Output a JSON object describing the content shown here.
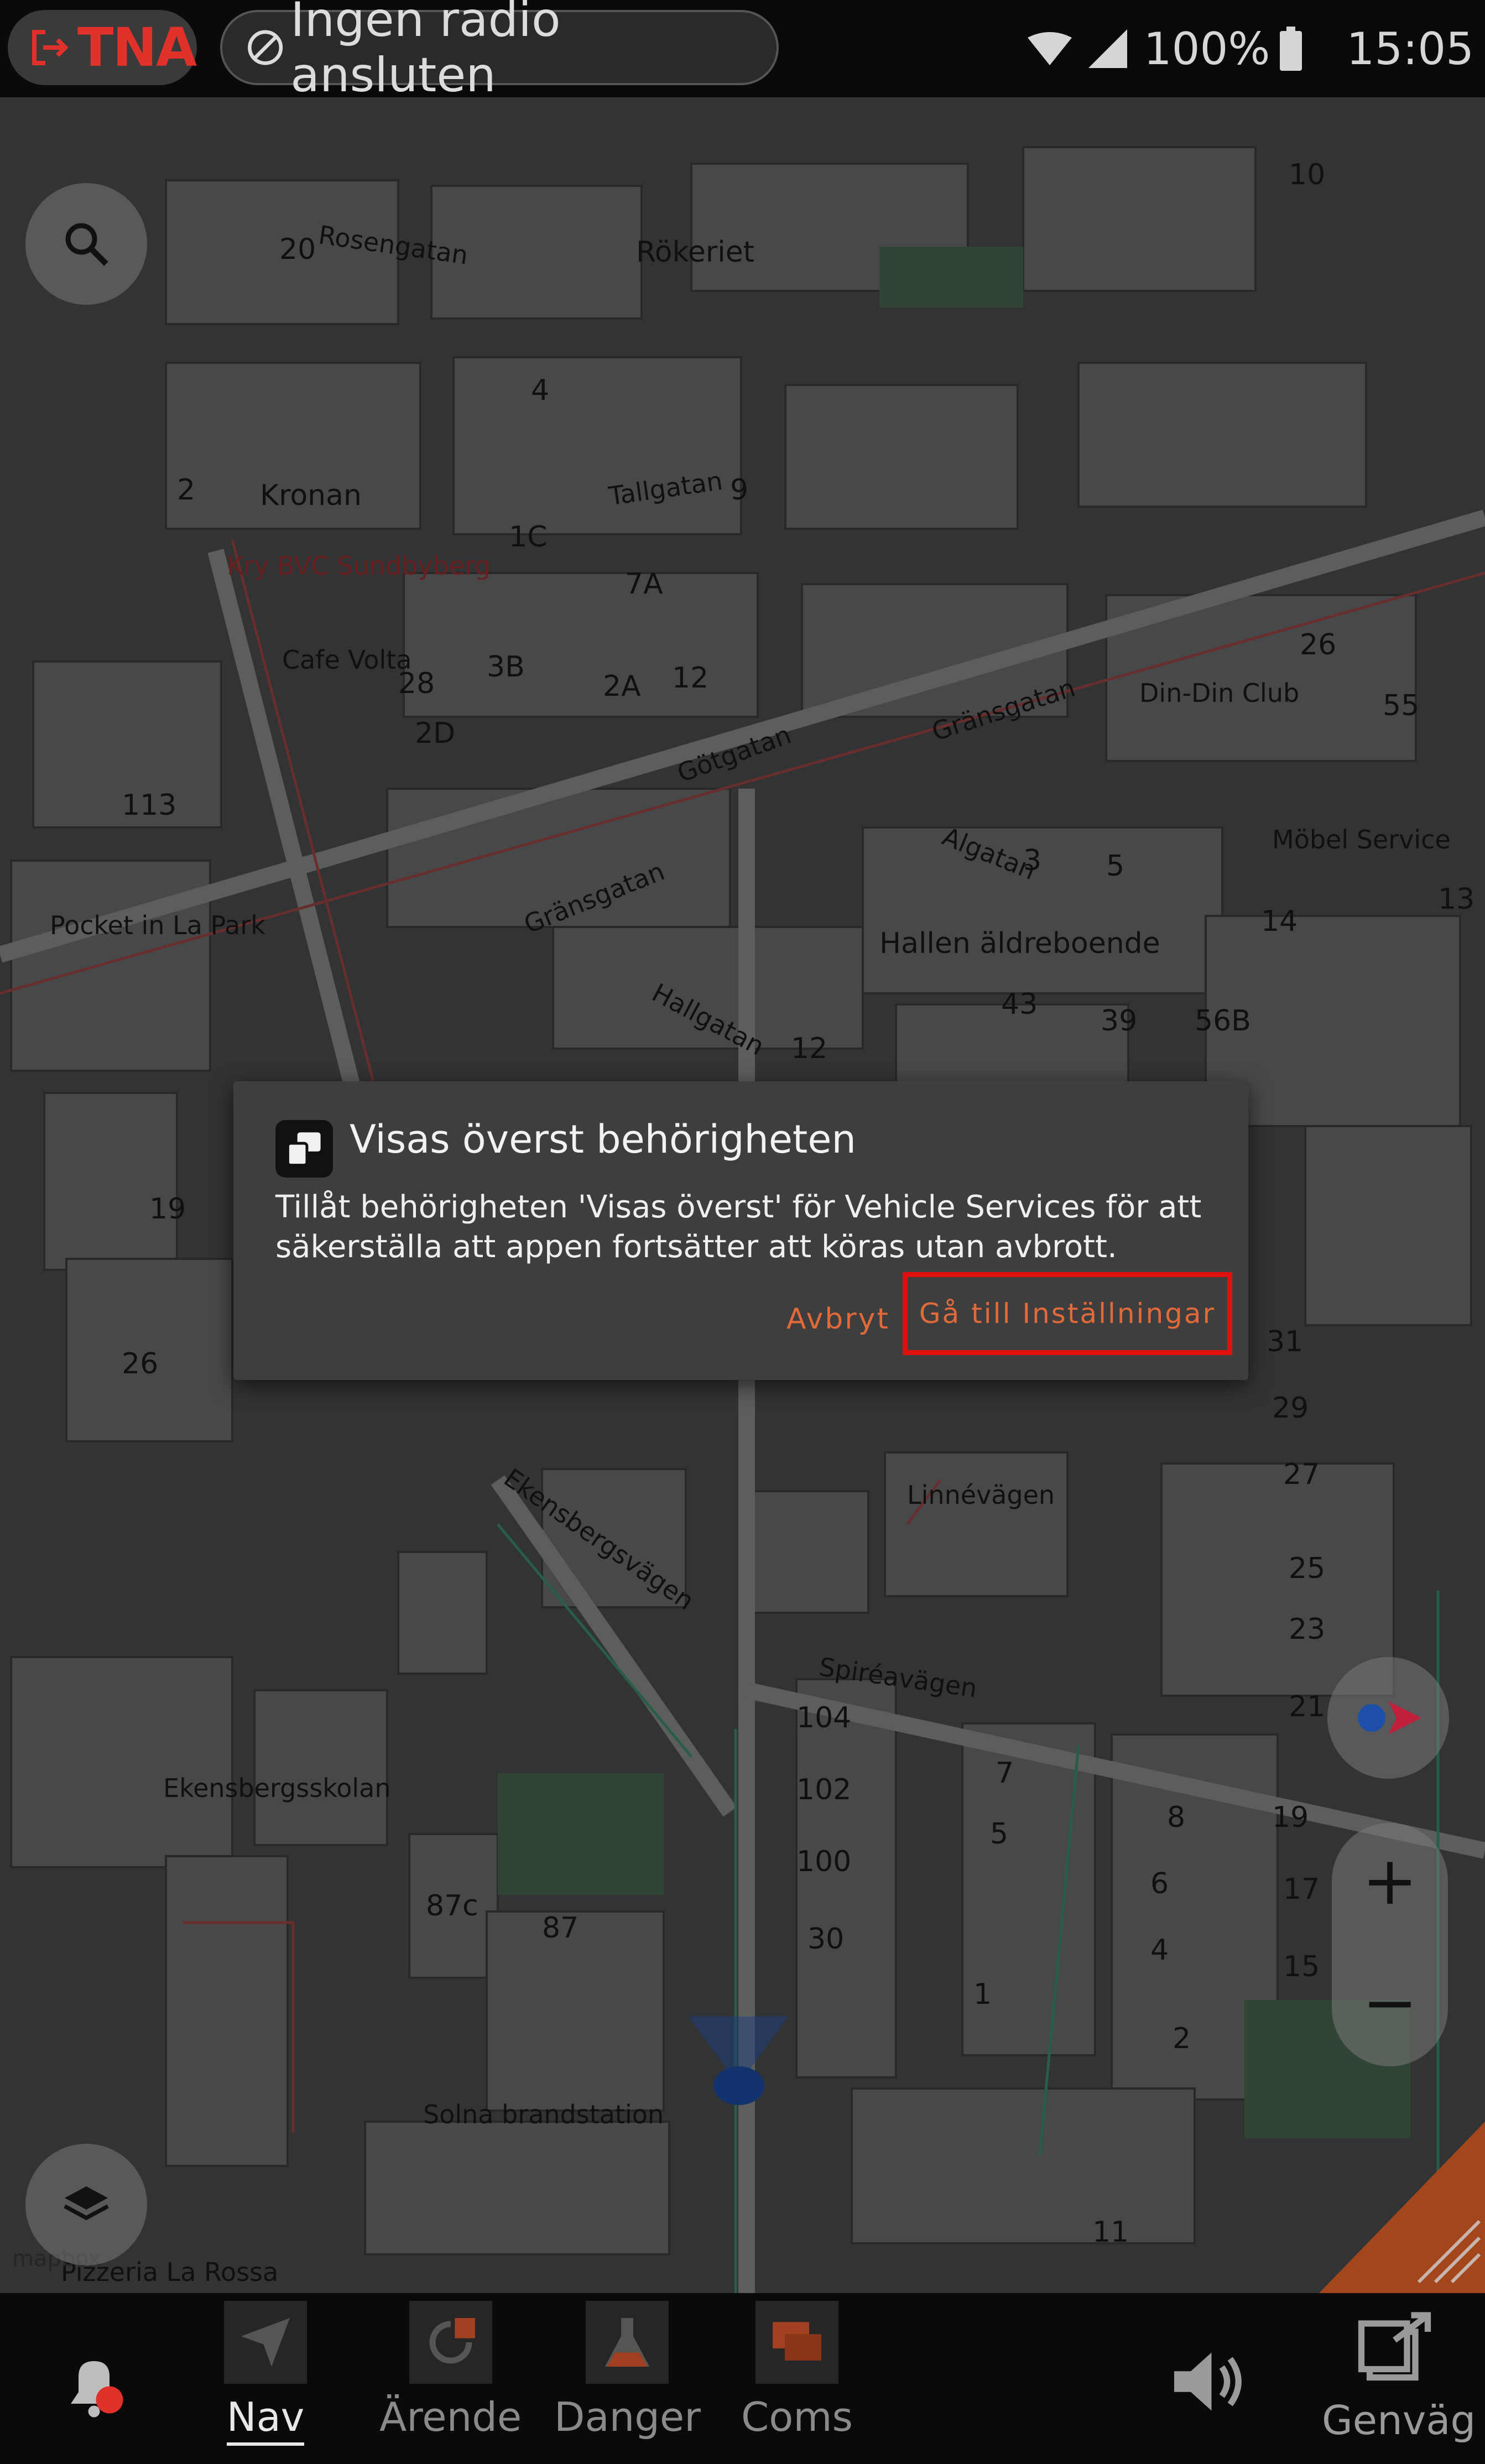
{
  "status_bar": {
    "app_badge": "TNA",
    "radio_status": "Ingen radio ansluten",
    "battery": "100%",
    "time": "15:05"
  },
  "map": {
    "labels": {
      "rokeriet": "Rökeriet",
      "kronan": "Kronan",
      "gransgatan": "Gränsgatan",
      "gransgatan2": "Gränsgatan",
      "gotgatan": "Götgatan",
      "hallen": "Hallen äldreboende",
      "linnevagen": "Linnévägen",
      "spireavagen": "Spiréavägen",
      "ekensbergsvagen": "Ekensbergsvägen",
      "ekensbergsskolan": "Ekensbergsskolan",
      "brandstation": "Solna brandstation",
      "pizzeria": "Pizzeria La Rossa",
      "pocket": "Pocket in La Park",
      "cafe_volta": "Cafe Volta",
      "din_din": "Din-Din Club",
      "mobel": "Möbel Service",
      "tallgatan": "Tallgatan",
      "kry": "Kry BVC Sundbyberg",
      "rosengatan": "Rosengatan",
      "hallgatan": "Hallgatan",
      "algatan": "Algatan"
    },
    "numbers": [
      "20",
      "9",
      "4",
      "2",
      "1C",
      "7A",
      "3B",
      "2A",
      "12",
      "2D",
      "28",
      "113",
      "19",
      "26",
      "3",
      "5",
      "56B",
      "43",
      "39",
      "12",
      "14",
      "13",
      "31",
      "29",
      "27",
      "25",
      "23",
      "21",
      "19",
      "17",
      "15",
      "8",
      "6",
      "4",
      "2",
      "1",
      "7",
      "5",
      "104",
      "102",
      "100",
      "30",
      "87",
      "87c",
      "11",
      "26",
      "55",
      "10"
    ],
    "credit": "mapbox",
    "zoom_in": "+",
    "zoom_out": "−"
  },
  "dialog": {
    "title": "Visas överst behörigheten",
    "message": "Tillåt behörigheten 'Visas överst' för Vehicle Services för att säkerställa att appen fortsätter att köras utan avbrott.",
    "cancel_label": "Avbryt",
    "settings_label": "Gå till Inställningar"
  },
  "bottom_nav": {
    "items": [
      {
        "label": "Nav",
        "icon": "navigation-arrow-icon",
        "active": true
      },
      {
        "label": "Ärende",
        "icon": "task-refresh-icon",
        "active": false
      },
      {
        "label": "Danger",
        "icon": "flask-icon",
        "active": false
      },
      {
        "label": "Coms",
        "icon": "chat-icon",
        "active": false
      }
    ],
    "shortcut_label": "Genväg"
  },
  "colors": {
    "accent": "#e06a3a",
    "highlight_border": "#e01010",
    "brand_red": "#e0322a",
    "dialog_bg": "#3e3e3e"
  }
}
